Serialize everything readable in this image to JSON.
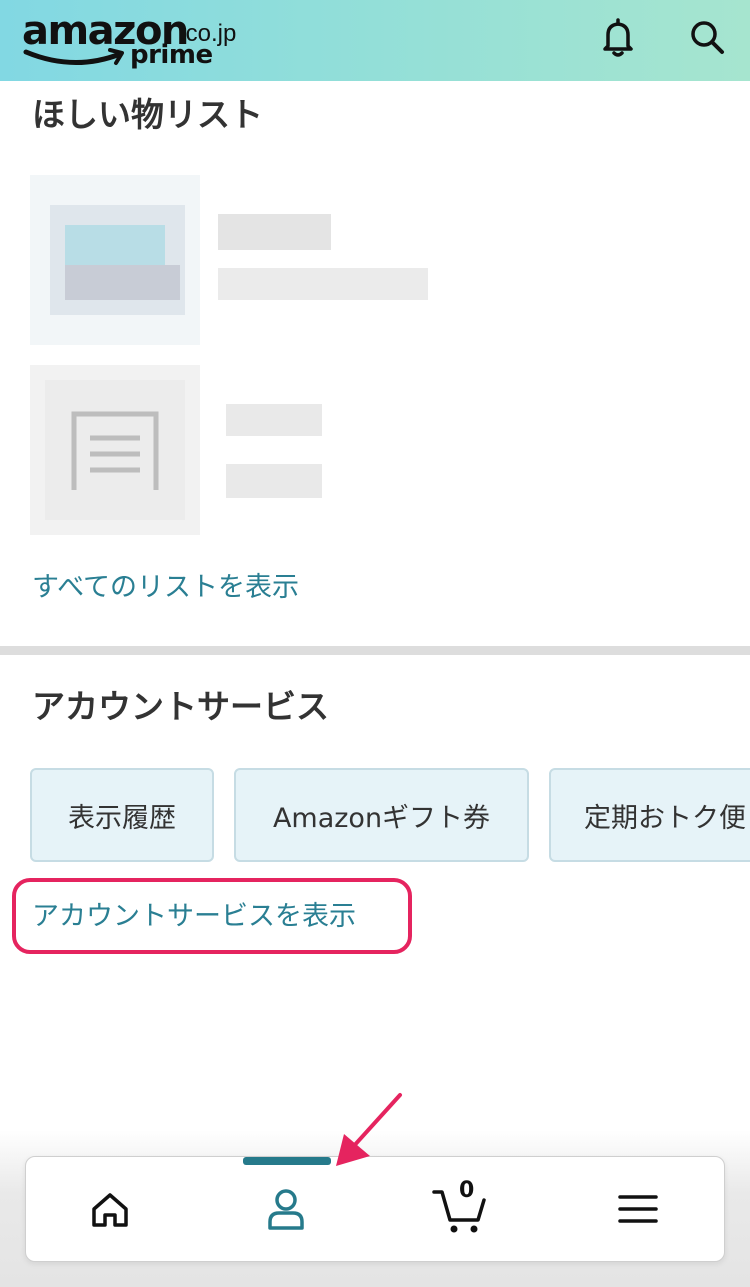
{
  "header": {
    "logo_word": "amazon",
    "logo_domain": ".co.jp",
    "logo_prime": "prime",
    "icons": [
      "bell-icon",
      "search-icon"
    ]
  },
  "wishlist": {
    "title": "ほしい物リスト",
    "see_all": "すべてのリストを表示"
  },
  "account_services": {
    "title": "アカウントサービス",
    "chips": [
      "表示履歴",
      "Amazonギフト券",
      "定期おトク便"
    ],
    "link": "アカウントサービスを表示"
  },
  "bottom_nav": {
    "items": [
      "home-icon",
      "user-icon",
      "cart-icon",
      "menu-icon"
    ],
    "cart_count": "0",
    "active": "user-icon"
  },
  "colors": {
    "link": "#2a7f93",
    "active_tab": "#267a8b",
    "highlight": "#e5245f",
    "header_gradient_start": "#82d8e3",
    "header_gradient_end": "#a6e5cf"
  }
}
